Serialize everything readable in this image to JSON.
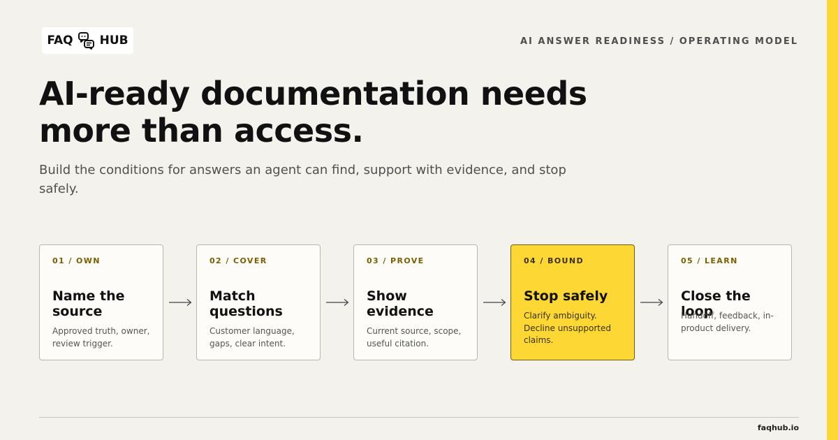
{
  "brand": {
    "logo_text_left": "FAQ",
    "logo_text_right": "HUB",
    "logo_icon": "chat-bubbles-icon",
    "accent_color": "#fdd835"
  },
  "eyebrow": "AI ANSWER READINESS / OPERATING MODEL",
  "headline": "AI-ready documentation needs more than access.",
  "subtitle": "Build the conditions for answers an agent can find, support with evidence, and stop safely.",
  "steps": [
    {
      "tag": "01 / OWN",
      "title": "Name the source",
      "description": "Approved truth, owner, review trigger.",
      "highlighted": false
    },
    {
      "tag": "02 / COVER",
      "title": "Match questions",
      "description": "Customer language, gaps, clear intent.",
      "highlighted": false
    },
    {
      "tag": "03 / PROVE",
      "title": "Show evidence",
      "description": "Current source, scope, useful citation.",
      "highlighted": false
    },
    {
      "tag": "04 / BOUND",
      "title": "Stop safely",
      "description": "Clarify ambiguity. Decline unsupported claims.",
      "highlighted": true
    },
    {
      "tag": "05 / LEARN",
      "title": "Close the loop",
      "description": "Handoff, feedback, in-product delivery.",
      "highlighted": false
    }
  ],
  "footer": {
    "url": "faqhub.io"
  }
}
